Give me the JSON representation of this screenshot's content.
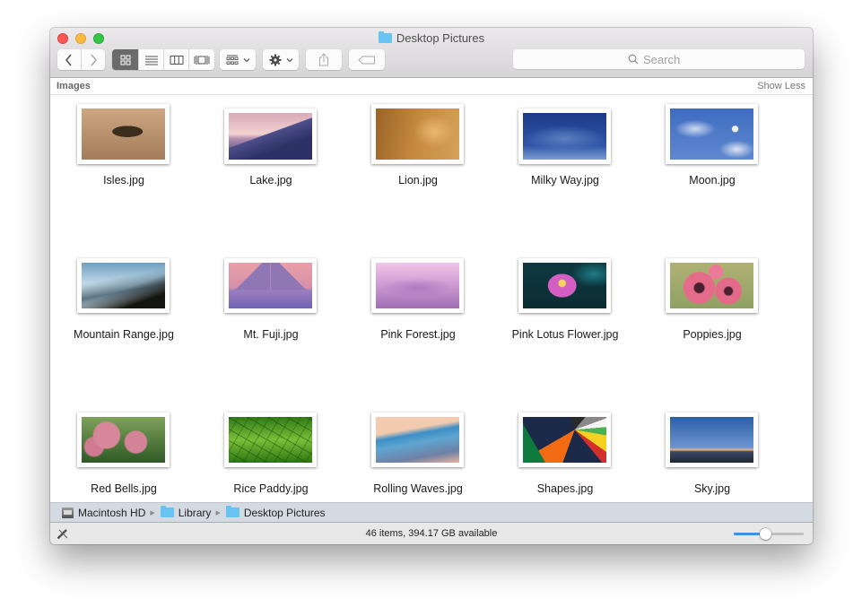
{
  "window": {
    "title": "Desktop Pictures",
    "title_icon": "folder-icon"
  },
  "toolbar": {
    "back_icon": "chevron-left-icon",
    "forward_icon": "chevron-right-icon",
    "view_modes": [
      {
        "name": "icon-view",
        "icon": "grid-icon",
        "active": true
      },
      {
        "name": "list-view",
        "icon": "list-icon",
        "active": false
      },
      {
        "name": "column-view",
        "icon": "columns-icon",
        "active": false
      },
      {
        "name": "cover-flow-view",
        "icon": "cover-flow-icon",
        "active": false
      }
    ],
    "arrange_icon": "arrange-grid-icon",
    "action_icon": "gear-icon",
    "share_icon": "share-icon",
    "tag_icon": "tag-icon",
    "search": {
      "placeholder": "Search",
      "value": ""
    }
  },
  "section": {
    "title": "Images",
    "toggle": "Show Less"
  },
  "items": [
    {
      "name": "Isles.jpg",
      "palette": [
        "#c9a07a",
        "#b58a65",
        "#4a3a26"
      ],
      "kind": "isles"
    },
    {
      "name": "Lake.jpg",
      "palette": [
        "#e8b0b8",
        "#5b5b9a",
        "#22285a"
      ],
      "kind": "lake"
    },
    {
      "name": "Lion.jpg",
      "palette": [
        "#c98b3e",
        "#8a5a24",
        "#e6b46a"
      ],
      "kind": "lion"
    },
    {
      "name": "Milky Way.jpg",
      "palette": [
        "#1f3e8c",
        "#2e56a8",
        "#8aa6d6"
      ],
      "kind": "milky"
    },
    {
      "name": "Moon.jpg",
      "palette": [
        "#3f6cc1",
        "#6f93d3",
        "#dbe5f3"
      ],
      "kind": "moon"
    },
    {
      "name": "Mountain Range.jpg",
      "palette": [
        "#b9d6e6",
        "#5c7686",
        "#15150f"
      ],
      "kind": "mountain"
    },
    {
      "name": "Mt. Fuji.jpg",
      "palette": [
        "#e89aa6",
        "#9b79b9",
        "#6c62b1"
      ],
      "kind": "fuji"
    },
    {
      "name": "Pink Forest.jpg",
      "palette": [
        "#e6b4df",
        "#c38fcc",
        "#a471b6"
      ],
      "kind": "pinkforest"
    },
    {
      "name": "Pink Lotus Flower.jpg",
      "palette": [
        "#0f3f44",
        "#d25fc4",
        "#f0d35a"
      ],
      "kind": "lotus"
    },
    {
      "name": "Poppies.jpg",
      "palette": [
        "#a6ab6f",
        "#e56b8b",
        "#6f8d55"
      ],
      "kind": "poppies"
    },
    {
      "name": "Red Bells.jpg",
      "palette": [
        "#3d6a2f",
        "#d88195",
        "#7da25a"
      ],
      "kind": "redbells"
    },
    {
      "name": "Rice Paddy.jpg",
      "palette": [
        "#3a8a1a",
        "#7fc23a",
        "#1d5a10"
      ],
      "kind": "rice"
    },
    {
      "name": "Rolling Waves.jpg",
      "palette": [
        "#f0c8a8",
        "#3c8fc6",
        "#6b7ea6"
      ],
      "kind": "waves"
    },
    {
      "name": "Shapes.jpg",
      "palette": [
        "#1c2a4a",
        "#f26a12",
        "#0e7a3e"
      ],
      "kind": "shapes"
    },
    {
      "name": "Sky.jpg",
      "palette": [
        "#2c5ea8",
        "#6b93cf",
        "#222a38"
      ],
      "kind": "sky"
    }
  ],
  "pathbar": [
    {
      "label": "Macintosh HD",
      "icon": "hard-drive-icon"
    },
    {
      "label": "Library",
      "icon": "folder-icon"
    },
    {
      "label": "Desktop Pictures",
      "icon": "folder-icon"
    }
  ],
  "status": {
    "text": "46 items, 394.17 GB available",
    "edit_icon": "pencil-crossed-icon",
    "icon_size_slider": 0.45
  },
  "colors": {
    "accent": "#3a92ee",
    "close": "#fc5753",
    "minimize": "#fdbc40",
    "maximize": "#33c748",
    "folder": "#67c3f1"
  }
}
